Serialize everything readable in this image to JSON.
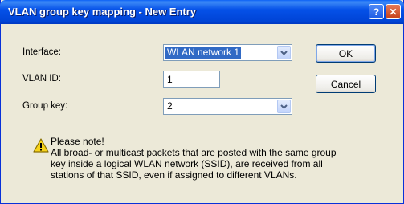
{
  "window": {
    "title": "VLAN group key mapping - New Entry",
    "help_label": "?",
    "close_label": "✕"
  },
  "form": {
    "interface_label": "Interface:",
    "interface_value": "WLAN network 1",
    "vlan_id_label": "VLAN ID:",
    "vlan_id_value": "1",
    "group_key_label": "Group key:",
    "group_key_value": "2"
  },
  "buttons": {
    "ok": "OK",
    "cancel": "Cancel"
  },
  "note": {
    "heading": "Please note!",
    "lines": [
      "All broad- or multicast packets that are posted with the same group",
      "key inside a logical WLAN network (SSID), are received from all",
      "stations of that SSID, even if assigned to different VLANs."
    ]
  },
  "colors": {
    "titlebar": "#0054e3",
    "selection": "#316ac5",
    "warning": "#f7d31a"
  },
  "icons": [
    "help-icon",
    "close-icon",
    "chevron-down-icon",
    "warning-icon"
  ]
}
